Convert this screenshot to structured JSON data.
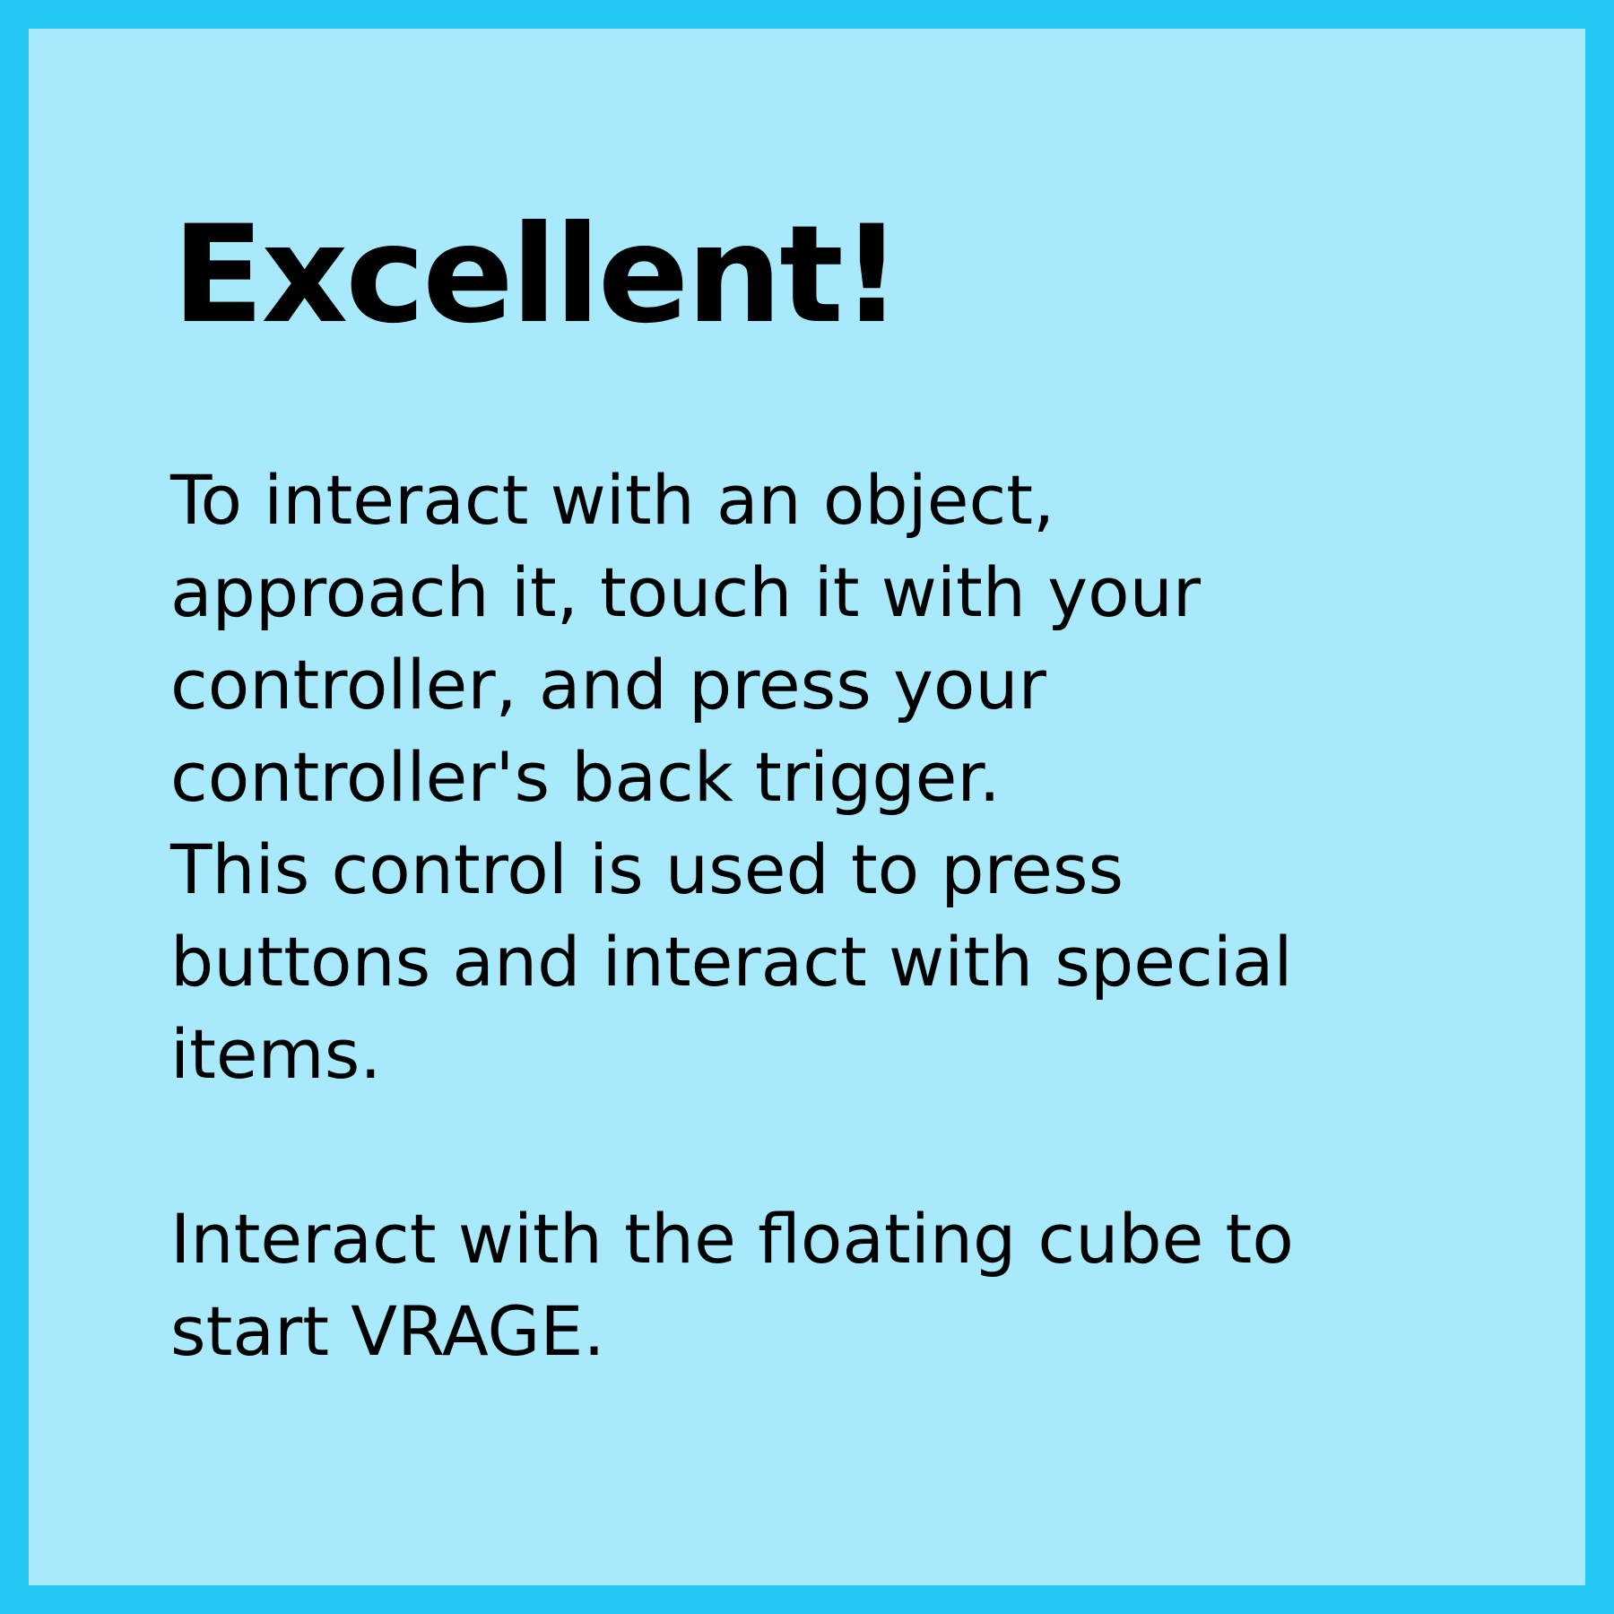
{
  "colors": {
    "border": "#22c8f2",
    "background": "#a8eafb",
    "text": "#000000"
  },
  "title": "Excellent!",
  "paragraphs": [
    {
      "lines": [
        "To interact with an object,",
        "approach it, touch it with your",
        "controller, and press your",
        "controller's back trigger."
      ]
    },
    {
      "lines": [
        "This control is used to press",
        "buttons and interact with special",
        "items."
      ]
    },
    {
      "lines": [
        "Interact with the floating cube to",
        "start VRAGE."
      ]
    }
  ]
}
